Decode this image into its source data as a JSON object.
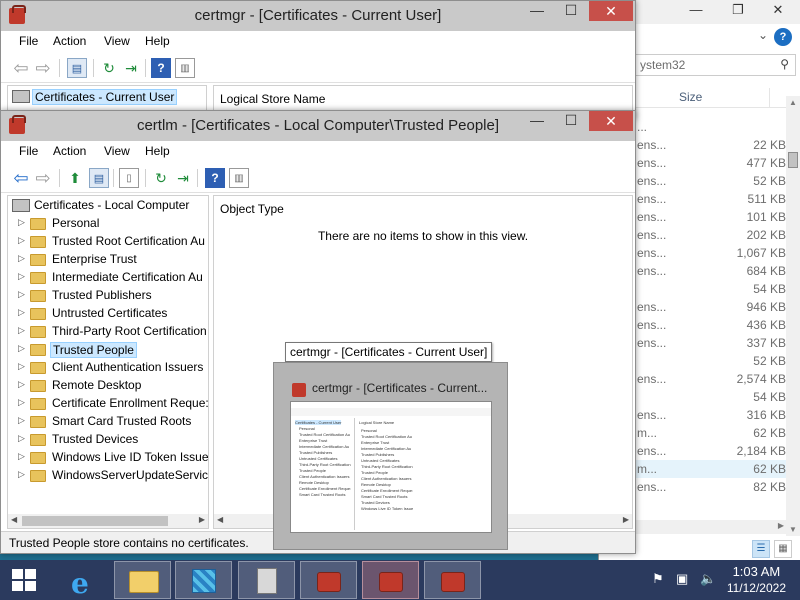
{
  "explorer": {
    "search_placeholder": "ystem32",
    "col_size": "Size",
    "rows": [
      {
        "name": "...",
        "size": ""
      },
      {
        "name": "ens...",
        "size": "22 KB"
      },
      {
        "name": "ens...",
        "size": "477 KB"
      },
      {
        "name": "ens...",
        "size": "52 KB"
      },
      {
        "name": "ens...",
        "size": "511 KB"
      },
      {
        "name": "ens...",
        "size": "101 KB"
      },
      {
        "name": "ens...",
        "size": "202 KB"
      },
      {
        "name": "ens...",
        "size": "1,067 KB"
      },
      {
        "name": "ens...",
        "size": "684 KB"
      },
      {
        "name": "",
        "size": "54 KB"
      },
      {
        "name": "ens...",
        "size": "946 KB"
      },
      {
        "name": "ens...",
        "size": "436 KB"
      },
      {
        "name": "ens...",
        "size": "337 KB"
      },
      {
        "name": "",
        "size": "52 KB"
      },
      {
        "name": "ens...",
        "size": "2,574 KB"
      },
      {
        "name": "",
        "size": "54 KB"
      },
      {
        "name": "ens...",
        "size": "316 KB"
      },
      {
        "name": "m...",
        "size": "62 KB"
      },
      {
        "name": "ens...",
        "size": "2,184 KB"
      },
      {
        "name": "m...",
        "size": "62 KB"
      },
      {
        "name": "ens...",
        "size": "82 KB"
      }
    ],
    "selected_row": 19
  },
  "certmgr": {
    "title": "certmgr - [Certificates - Current User]",
    "menu": [
      "File",
      "Action",
      "View",
      "Help"
    ],
    "tree_root": "Certificates - Current User",
    "right_col": "Logical Store Name"
  },
  "certlm": {
    "title": "certlm - [Certificates - Local Computer\\Trusted People]",
    "menu": [
      "File",
      "Action",
      "View",
      "Help"
    ],
    "tree_root": "Certificates - Local Computer",
    "tree_items": [
      "Personal",
      "Trusted Root Certification Au",
      "Enterprise Trust",
      "Intermediate Certification Au",
      "Trusted Publishers",
      "Untrusted Certificates",
      "Third-Party Root Certification",
      "Trusted People",
      "Client Authentication Issuers",
      "Remote Desktop",
      "Certificate Enrollment Reque:",
      "Smart Card Trusted Roots",
      "Trusted Devices",
      "Windows Live ID Token Issue",
      "WindowsServerUpdateService"
    ],
    "selected_item": "Trusted People",
    "right_col": "Object Type",
    "empty_message": "There are no items to show in this view.",
    "status": "Trusted People store contains no certificates."
  },
  "thumbnail": {
    "tooltip": "certmgr - [Certificates - Current User]",
    "title": "certmgr - [Certificates - Current..."
  },
  "taskbar": {
    "time": "1:03 AM",
    "date": "11/12/2022"
  },
  "colors": {
    "desktop": "#1e6e8e",
    "taskbar": "#2b3a5e",
    "close_button": "#c7504a",
    "selection": "#cce8ff"
  }
}
